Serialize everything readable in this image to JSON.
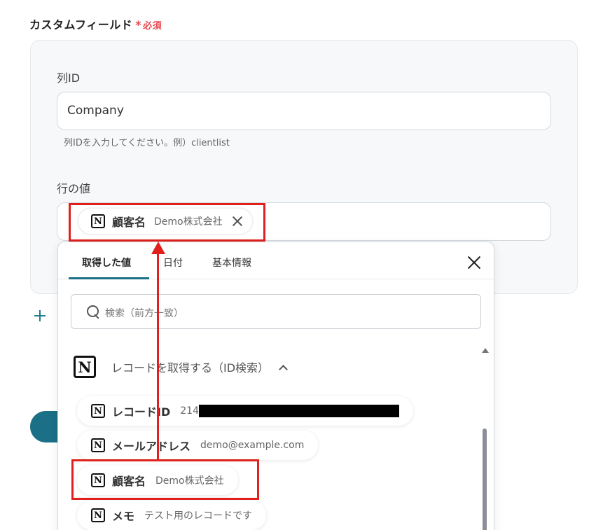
{
  "section": {
    "title": "カスタムフィールド",
    "required_mark": "*",
    "required_text": "必須"
  },
  "column_id": {
    "label": "列ID",
    "value": "Company",
    "hint": "列IDを入力してください。例）clientlist"
  },
  "row_value": {
    "label": "行の値",
    "chip": {
      "name": "顧客名",
      "sub": "Demo株式会社"
    }
  },
  "dropdown": {
    "tabs": [
      {
        "label": "取得した値"
      },
      {
        "label": "日付"
      },
      {
        "label": "基本情報"
      }
    ],
    "search_placeholder": "検索（前方一致）",
    "group_label": "レコードを取得する（ID検索）",
    "items": [
      {
        "name": "レコードID",
        "sub": "214"
      },
      {
        "name": "メールアドレス",
        "sub": "demo@example.com"
      },
      {
        "name": "顧客名",
        "sub": "Demo株式会社"
      },
      {
        "name": "メモ",
        "sub": "テスト用のレコードです"
      }
    ]
  },
  "icons": {
    "notion": "N"
  },
  "colors": {
    "accent": "#1b6f86",
    "required": "#e5484d",
    "highlight": "#e0201c"
  }
}
